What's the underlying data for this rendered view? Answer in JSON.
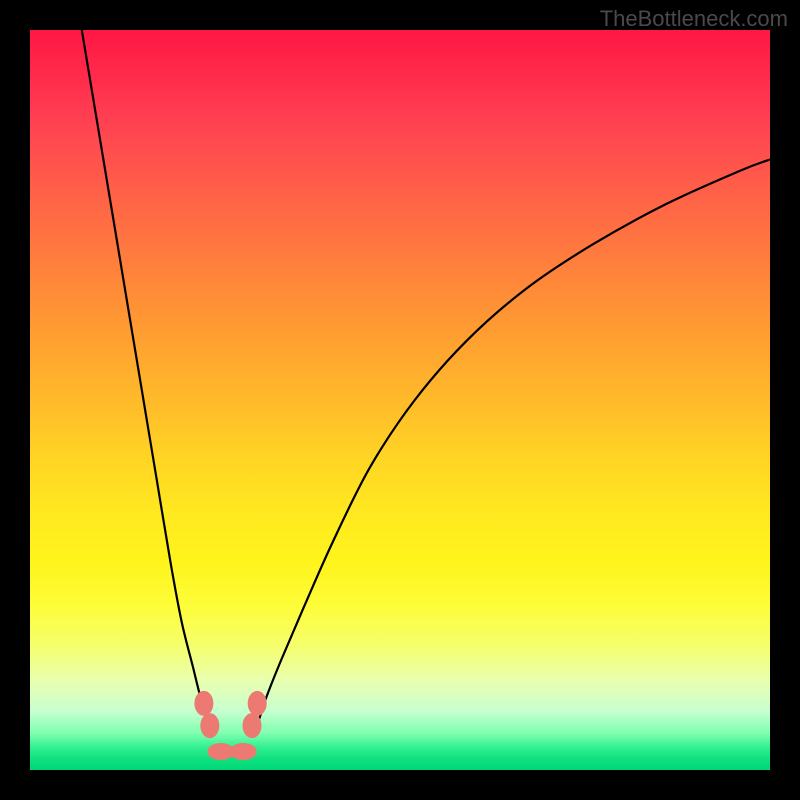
{
  "attribution": "TheBottleneck.com",
  "chart_data": {
    "type": "line",
    "title": "",
    "xlabel": "",
    "ylabel": "",
    "xlim": [
      0,
      100
    ],
    "ylim": [
      0,
      100
    ],
    "series": [
      {
        "name": "left-branch",
        "x": [
          7,
          9,
          11,
          13,
          15,
          17,
          19,
          20.5,
          22,
          23,
          24,
          24.8
        ],
        "y": [
          100,
          88,
          76,
          64,
          52,
          40,
          28,
          20,
          14,
          10,
          7,
          5
        ]
      },
      {
        "name": "right-branch",
        "x": [
          30.2,
          31,
          32,
          34,
          37,
          41,
          46,
          52,
          59,
          67,
          76,
          86,
          96,
          100
        ],
        "y": [
          5,
          7,
          10,
          15,
          22,
          31,
          41,
          50,
          58,
          65,
          71,
          76.5,
          81,
          82.5
        ]
      }
    ],
    "markers": [
      {
        "name": "left-marker-top",
        "x": 23.5,
        "y": 9
      },
      {
        "name": "left-marker-bot",
        "x": 24.3,
        "y": 6
      },
      {
        "name": "right-marker-top",
        "x": 30.7,
        "y": 9
      },
      {
        "name": "right-marker-bot",
        "x": 30.0,
        "y": 6
      },
      {
        "name": "valley-marker-left",
        "x": 25.8,
        "y": 2.5
      },
      {
        "name": "valley-marker-right",
        "x": 28.8,
        "y": 2.5
      }
    ],
    "valley_x": 27.5
  }
}
